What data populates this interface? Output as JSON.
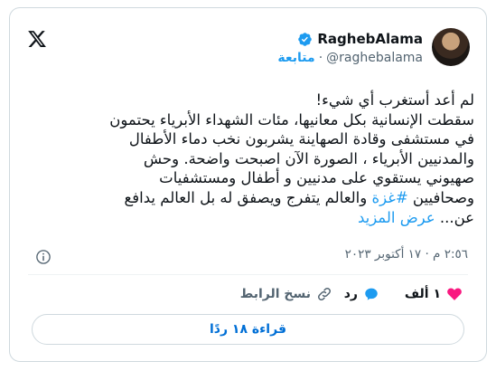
{
  "author": {
    "name": "RaghebAlama",
    "handle": "@raghebalama",
    "separator": "·",
    "follow_label": "متابعة",
    "verified_icon": "verified-badge-icon",
    "verified_color": "#1d9bf0"
  },
  "tweet": {
    "lines": [
      "لم أعد أستغرب أي شيء!",
      "سقطت الإنسانية بكل معانيها، مئات الشهداء الأبرياء يحتمون",
      "في مستشفى وقادة الصهاينة يشربون نخب دماء الأطفال",
      "والمدنيين الأبرياء ، الصورة الآن اصبحت واضحة. وحش",
      "صهيوني يستقوي على مدنيين و أطفال ومستشفيات"
    ],
    "line6_before": "وصحافيين ",
    "hashtag": "#غزة",
    "line6_after": "  والعالم يتفرج ويصفق له بل العالم يدافع",
    "line7_text": "عن... ",
    "show_more": "عرض المزيد"
  },
  "timestamp": "٢:٥٦ م · ١٧ أكتوبر ٢٠٢٣",
  "actions": {
    "like_count": "١ ألف",
    "reply_label": "رد",
    "copy_link_label": "نسخ الرابط"
  },
  "read_replies_label": "قراءة ١٨ ردًا",
  "colors": {
    "accent": "#1d9bf0",
    "like": "#f91880",
    "text": "#0f1419",
    "muted": "#536471",
    "border": "#cfd9de"
  }
}
